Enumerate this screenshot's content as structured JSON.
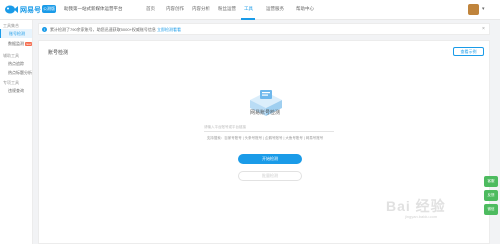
{
  "header": {
    "brand": "网易号",
    "beta_badge": "公测版",
    "slogan": "助我第一站式新媒体运营平台",
    "nav": [
      "首页",
      "内容创作",
      "内容分析",
      "粉丝运营",
      "工具",
      "运营服务",
      "帮助中心"
    ],
    "active_nav": "工具",
    "user_caret": "▾"
  },
  "sidebar": {
    "group1": "工具集合",
    "items1": [
      {
        "label": "账号检测",
        "active": true
      },
      {
        "label": "数据监测",
        "badge": "new"
      }
    ],
    "group2": "辅助工具",
    "items2": [
      {
        "label": "热点追踪"
      },
      {
        "label": "热点标题分析"
      }
    ],
    "group3": "专项工具",
    "items3": [
      {
        "label": "违规查询"
      }
    ]
  },
  "notice": {
    "icon": "!",
    "text": "累计检测了790余家账号，助您迅速获取5000+权威账号信息  ",
    "link": "立即检测看看",
    "close": "×"
  },
  "main": {
    "title": "账号检测",
    "view_demo": "查看示例",
    "empty_title": "网易账号检测",
    "search_placeholder": "请输入平台账号或平台链接",
    "tip_row": "支持搜索：百家号账号 | 头条号账号 | 企鹅号账号 | 大鱼号账号 | 网易号账号",
    "start_button": "开始检测",
    "batch_button": "批量检测"
  },
  "float_tools": [
    "客服",
    "反馈",
    "微信"
  ],
  "watermark": {
    "text": "Bai 经验",
    "sub": "jingyan.baidu.com"
  },
  "colors": {
    "accent": "#1a9be8",
    "badge": "#f56c4e",
    "float_green": "#4dbb5f"
  }
}
